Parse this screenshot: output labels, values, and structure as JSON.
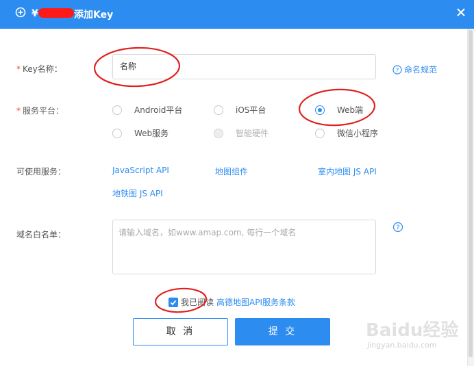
{
  "dialog": {
    "title_prefix": "¥",
    "title": "添加Key",
    "close_icon": "close-icon"
  },
  "form": {
    "key_name": {
      "label": "Key名称：",
      "required_mark": "*",
      "value": "名称",
      "help_label": "命名规范"
    },
    "platform": {
      "label": "服务平台：",
      "required_mark": "*",
      "options": [
        {
          "label": "Android平台",
          "checked": false,
          "disabled": false
        },
        {
          "label": "iOS平台",
          "checked": false,
          "disabled": false
        },
        {
          "label": "Web端",
          "checked": true,
          "disabled": false
        },
        {
          "label": "Web服务",
          "checked": false,
          "disabled": false
        },
        {
          "label": "智能硬件",
          "checked": false,
          "disabled": true
        },
        {
          "label": "微信小程序",
          "checked": false,
          "disabled": false
        }
      ]
    },
    "services": {
      "label": "可使用服务：",
      "items": [
        "JavaScript API",
        "地图组件",
        "室内地图 JS API",
        "地铁图 JS API"
      ]
    },
    "whitelist": {
      "label": "域名白名单：",
      "placeholder": "请输入域名，如www.amap.com, 每行一个域名"
    },
    "agreement": {
      "checked": true,
      "text": "我已阅读",
      "link": "高德地图API服务条款"
    }
  },
  "buttons": {
    "cancel": "取 消",
    "submit": "提 交"
  },
  "watermark": {
    "logo": "Baidu经验",
    "url": "jingyan.baidu.com"
  },
  "colors": {
    "primary": "#2d8cf0",
    "header": "#2d8cf0",
    "required": "#e64c3c",
    "annotation": "#e0201f"
  }
}
